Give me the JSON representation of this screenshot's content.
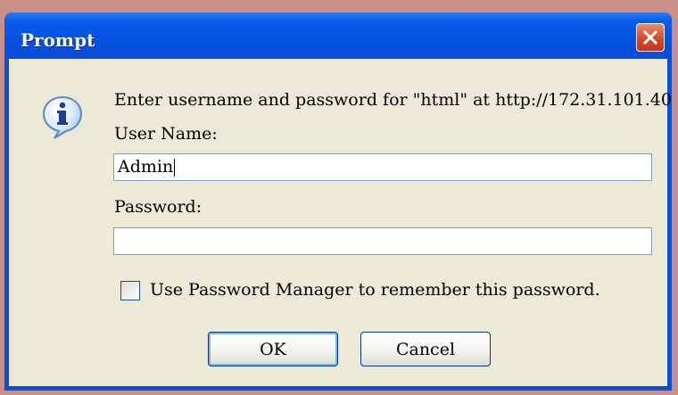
{
  "window": {
    "title": "Prompt",
    "close_icon": "close-icon"
  },
  "dialog": {
    "icon": "info-icon",
    "message": "Enter username and password for \"html\" at http://172.31.101.40",
    "username_label": "User Name:",
    "username_value": "Admin",
    "password_label": "Password:",
    "password_value": "",
    "remember_label": "Use Password Manager to remember this password.",
    "remember_checked": false,
    "ok_label": "OK",
    "cancel_label": "Cancel"
  },
  "colors": {
    "titlebar": "#0553e2",
    "client_bg": "#ece9d8",
    "close_button": "#d24a2a",
    "field_border": "#7f9db9",
    "button_border": "#003c74"
  }
}
